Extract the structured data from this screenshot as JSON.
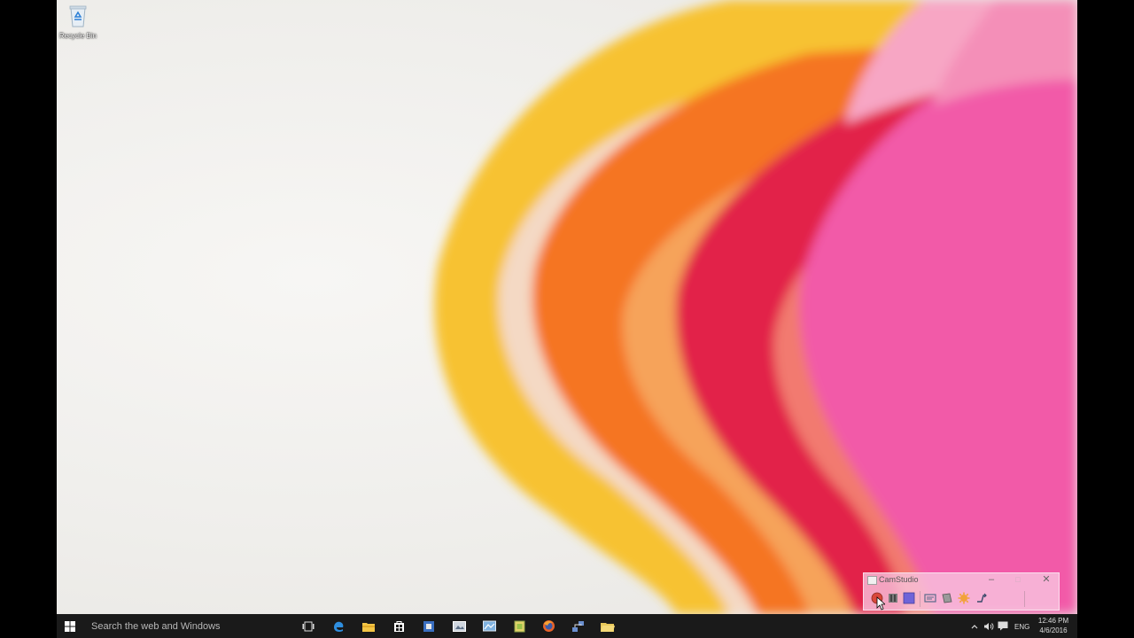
{
  "desktop": {
    "icons": [
      {
        "label": "Recycle Bin",
        "icon": "recycle-bin-icon"
      }
    ]
  },
  "camstudio": {
    "title": "CamStudio",
    "controls": {
      "minimize": "–",
      "maximize": "□",
      "close": "✕"
    },
    "toolbar": [
      {
        "icon": "record-icon",
        "color": "#d9473a"
      },
      {
        "icon": "pause-icon",
        "color": "#6a6a6a"
      },
      {
        "icon": "stop-icon",
        "color": "#6f64d8"
      },
      {
        "icon": "screen-annotation-icon",
        "color": "#5a6a8a"
      },
      {
        "icon": "video-annotation-icon",
        "color": "#6a6a6a"
      },
      {
        "icon": "options-icon",
        "color": "#f2a23a"
      },
      {
        "icon": "toggle-view-icon",
        "color": "#3a4a6a"
      }
    ]
  },
  "taskbar": {
    "search_placeholder": "Search the web and Windows",
    "apps": [
      "start-icon",
      "task-view-icon",
      "edge-icon",
      "file-explorer-icon",
      "store-icon",
      "app-icon",
      "media-icon",
      "photos-icon",
      "file-icon",
      "firefox-icon",
      "network-tool-icon",
      "folder-icon"
    ],
    "tray": {
      "language": "ENG",
      "time": "12:46 PM",
      "date": "4/6/2016"
    }
  },
  "colors": {
    "taskbar": "#1a1a1a",
    "accent_pink": "#f25aa8",
    "accent_orange": "#f57420",
    "accent_yellow": "#f7c230"
  }
}
